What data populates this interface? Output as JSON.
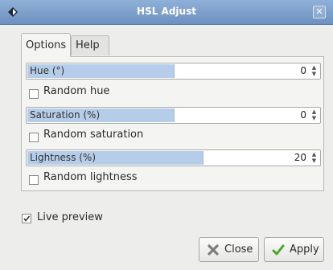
{
  "window": {
    "title": "HSL Adjust"
  },
  "tabs": [
    {
      "label": "Options"
    },
    {
      "label": "Help"
    }
  ],
  "hue": {
    "label": "Hue (°)",
    "value": "0",
    "fill": 0.5,
    "random_label": "Random hue"
  },
  "saturation": {
    "label": "Saturation (%)",
    "value": "0",
    "fill": 0.5,
    "random_label": "Random saturation"
  },
  "lightness": {
    "label": "Lightness (%)",
    "value": "20",
    "fill": 0.6,
    "random_label": "Random lightness"
  },
  "live_preview": {
    "label": "Live preview",
    "checked": true
  },
  "buttons": {
    "close": "Close",
    "apply": "Apply"
  },
  "icons": {
    "app": "app-icon",
    "close_window": "close-window-icon",
    "close": "close-icon",
    "apply": "checkmark-icon"
  }
}
